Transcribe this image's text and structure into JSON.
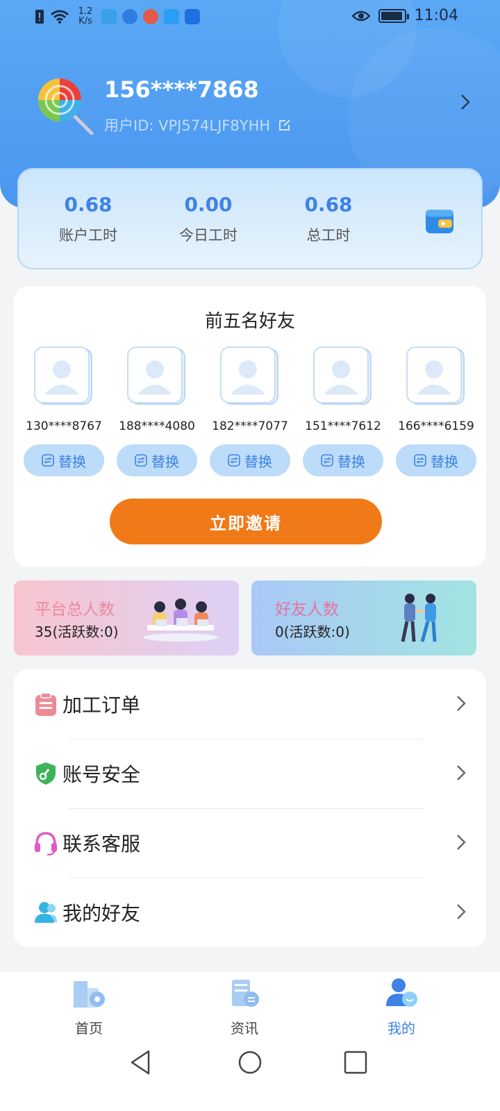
{
  "status_bar": {
    "speed_value": "1.2",
    "speed_unit": "K/s",
    "time": "11:04"
  },
  "profile": {
    "phone": "156****7868",
    "user_id": "用户ID: VPJ574LJF8YHH"
  },
  "stats": [
    {
      "value": "0.68",
      "label": "账户工时"
    },
    {
      "value": "0.00",
      "label": "今日工时"
    },
    {
      "value": "0.68",
      "label": "总工时"
    }
  ],
  "friends": {
    "title": "前五名好友",
    "items": [
      {
        "phone": "130****8767",
        "button": "替换"
      },
      {
        "phone": "188****4080",
        "button": "替换"
      },
      {
        "phone": "182****7077",
        "button": "替换"
      },
      {
        "phone": "151****7612",
        "button": "替换"
      },
      {
        "phone": "166****6159",
        "button": "替换"
      }
    ],
    "invite_label": "立即邀请"
  },
  "counts": {
    "platform": {
      "title": "平台总人数",
      "value": "35(活跃数:0)"
    },
    "friends": {
      "title": "好友人数",
      "value": "0(活跃数:0)"
    }
  },
  "menu": [
    {
      "label": "加工订单",
      "icon": "clipboard-icon",
      "color": "#ee8a96"
    },
    {
      "label": "账号安全",
      "icon": "shield-icon",
      "color": "#3db35a"
    },
    {
      "label": "联系客服",
      "icon": "headset-icon",
      "color": "#e05bc4"
    },
    {
      "label": "我的好友",
      "icon": "users-icon",
      "color": "#34b4e0"
    }
  ],
  "bottom_nav": [
    {
      "label": "首页",
      "icon": "home-icon",
      "active": false
    },
    {
      "label": "资讯",
      "icon": "news-icon",
      "active": false
    },
    {
      "label": "我的",
      "icon": "profile-icon",
      "active": true
    }
  ],
  "colors": {
    "primary": "#4b96f0",
    "accent_blue": "#3f82e6",
    "invite_orange": "#ef7a17"
  }
}
